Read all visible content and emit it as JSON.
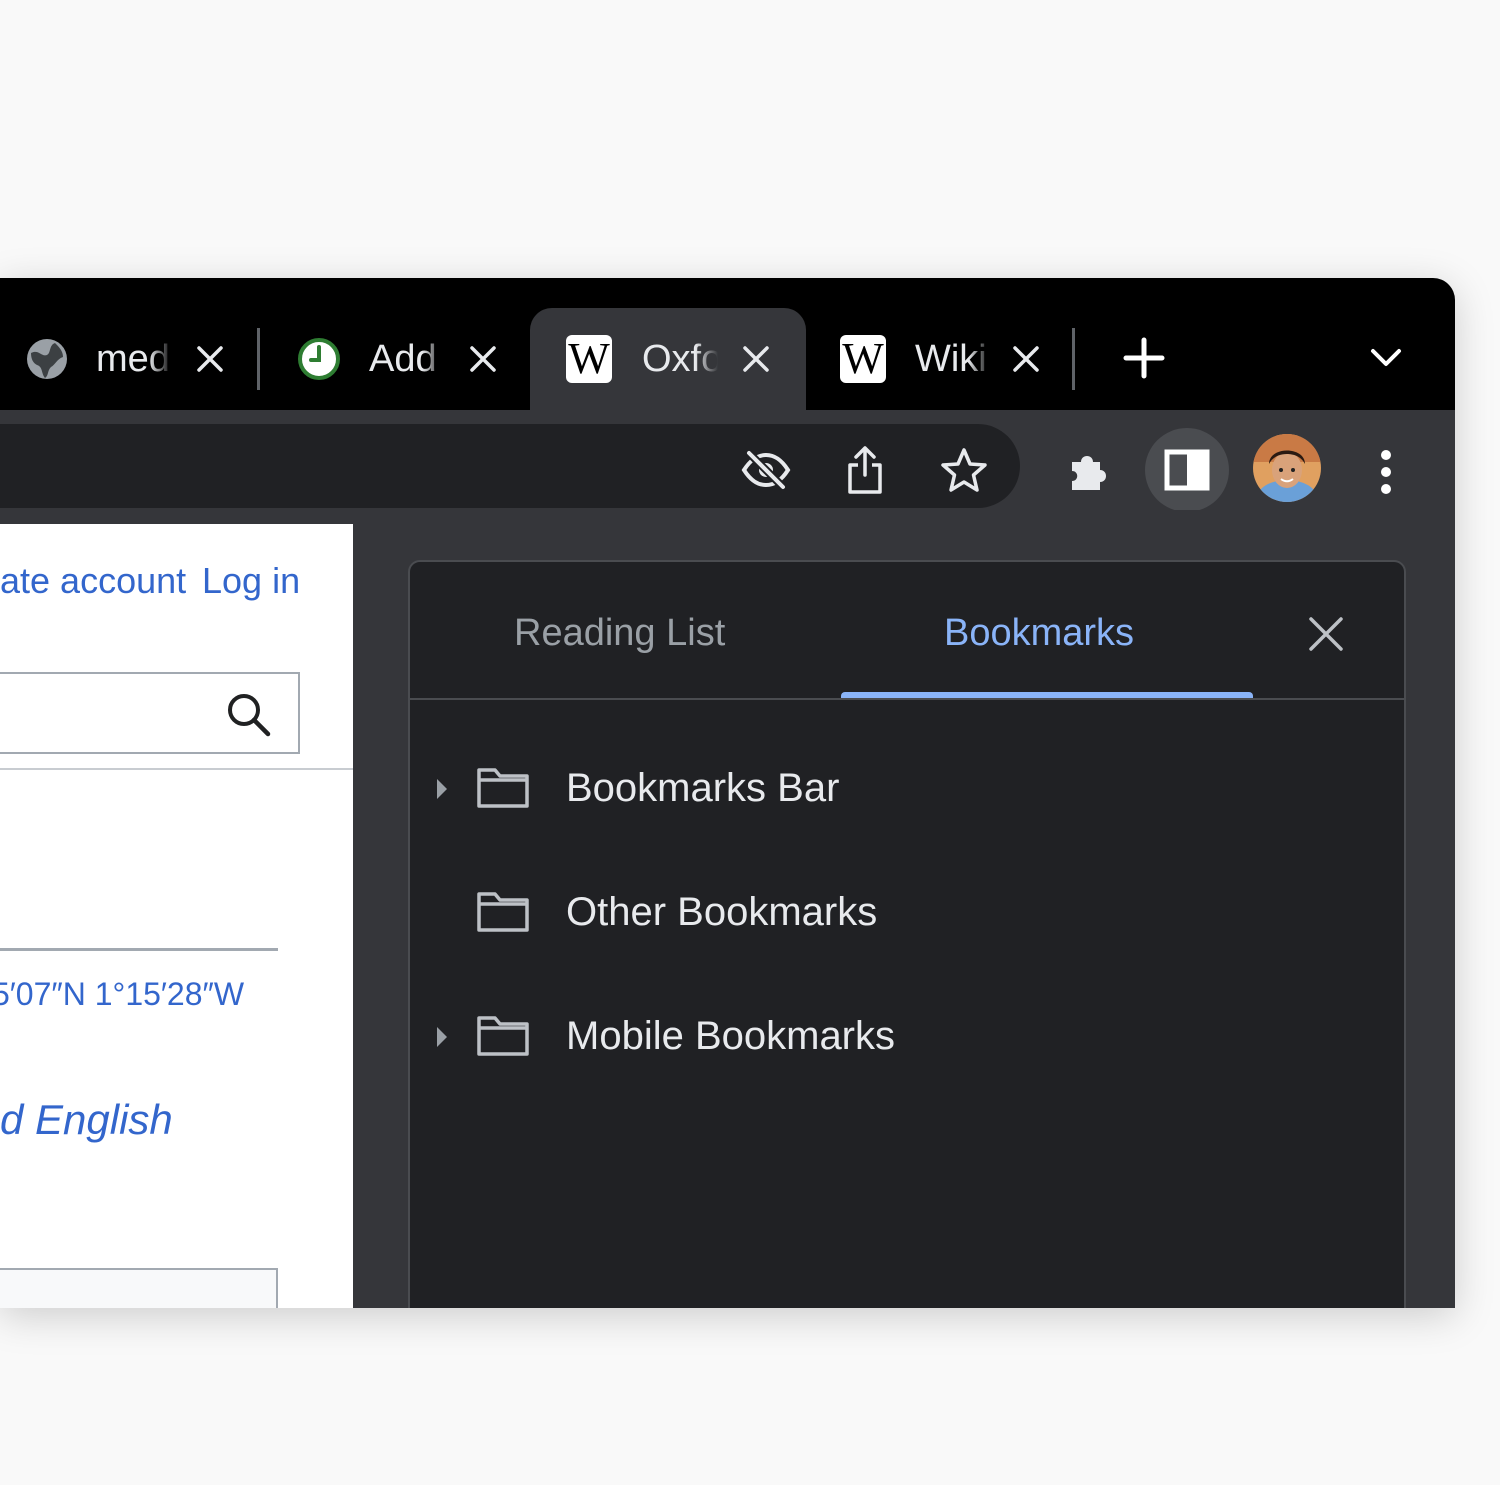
{
  "tabs": [
    {
      "title": "med",
      "favicon": "globe-icon"
    },
    {
      "title": "Add",
      "favicon": "clock-icon"
    },
    {
      "title": "Oxfo",
      "favicon": "wikipedia-icon",
      "active": true
    },
    {
      "title": "Wiki",
      "favicon": "wikipedia-icon"
    }
  ],
  "wiki_logo_letter": "W",
  "webpage": {
    "create_account": "ate account",
    "login": "Log in",
    "coordinates": "5′07″N 1°15′28″W",
    "english_link": "d English"
  },
  "side_panel": {
    "tabs": [
      {
        "label": "Reading List",
        "active": false
      },
      {
        "label": "Bookmarks",
        "active": true
      }
    ],
    "folders": [
      {
        "label": "Bookmarks Bar",
        "expandable": true
      },
      {
        "label": "Other Bookmarks",
        "expandable": false
      },
      {
        "label": "Mobile Bookmarks",
        "expandable": true
      }
    ]
  },
  "colors": {
    "accent": "#8ab4f8",
    "link": "#3366cc",
    "frame": "#000000",
    "toolbar": "#35363a",
    "panel": "#202124"
  }
}
